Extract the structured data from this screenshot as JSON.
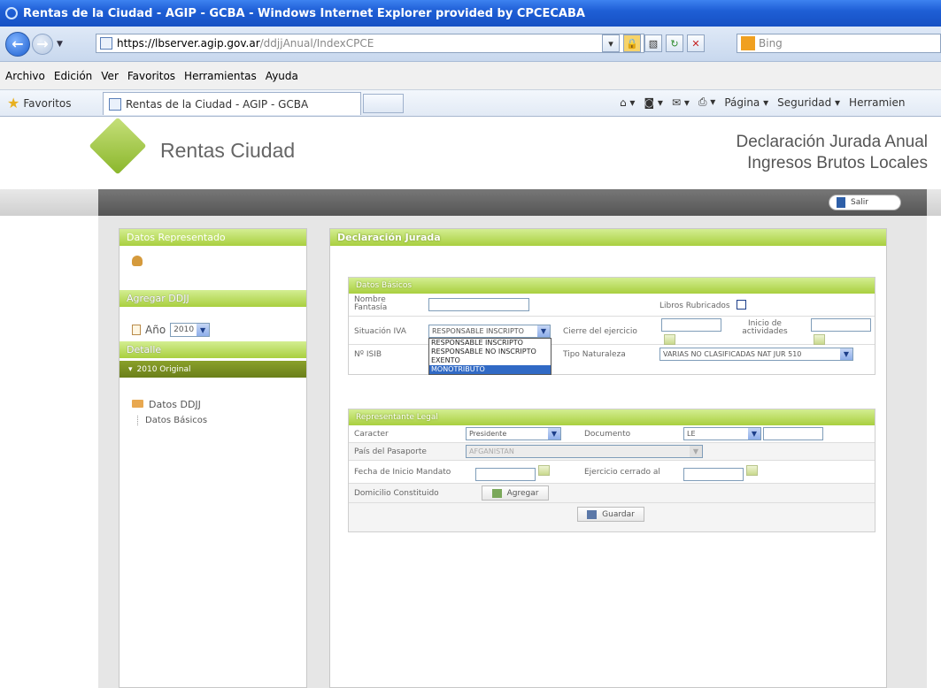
{
  "browser": {
    "window_title": "Rentas de la Ciudad - AGIP - GCBA - Windows Internet Explorer provided by CPCECABA",
    "url_host": "https://lbserver.agip.gov.ar",
    "url_path": "/ddjjAnual/IndexCPCE",
    "search_placeholder": "Bing",
    "menu": [
      "Archivo",
      "Edición",
      "Ver",
      "Favoritos",
      "Herramientas",
      "Ayuda"
    ],
    "favorites_label": "Favoritos",
    "tab_title": "Rentas de la Ciudad - AGIP - GCBA",
    "commands": [
      "Página ▾",
      "Seguridad ▾",
      "Herramien"
    ]
  },
  "header": {
    "brand": "Rentas Ciudad",
    "title_line1": "Declaración Jurada Anual",
    "title_line2": "Ingresos Brutos Locales",
    "logout_label": "Salir"
  },
  "sidebar": {
    "represented_title": "Datos Representado",
    "add_ddjj_title": "Agregar DDJJ",
    "year_label": "Año",
    "year_value": "2010",
    "detail_title": "Detalle",
    "detail_item": "2010 Original",
    "tree_root": "Datos DDJJ",
    "tree_child": "Datos Básicos"
  },
  "main": {
    "title": "Declaración Jurada",
    "basic": {
      "title": "Datos Básicos",
      "fantasy_label": "Nombre Fantasía",
      "fantasy_value": "",
      "books_label": "Libros Rubricados",
      "iva_label": "Situación IVA",
      "iva_value": "RESPONSABLE INSCRIPTO",
      "iva_options": [
        "RESPONSABLE INSCRIPTO",
        "RESPONSABLE NO INSCRIPTO",
        "EXENTO",
        "MONOTRIBUTO"
      ],
      "iva_highlighted": "MONOTRIBUTO",
      "closing_label": "Cierre del ejercicio",
      "start_label": "Inicio de actividades",
      "isib_label": "Nº ISIB",
      "nature_label": "Tipo Naturaleza",
      "nature_value": "VARIAS NO CLASIFICADAS NAT JUR 510"
    },
    "legal": {
      "title": "Representante Legal",
      "caracter_label": "Caracter",
      "caracter_value": "Presidente",
      "documento_label": "Documento",
      "documento_value": "LE",
      "pais_label": "País del Pasaporte",
      "pais_value": "AFGANISTAN",
      "mandato_label": "Fecha de Inicio Mandato",
      "ejercicio_label": "Ejercicio cerrado al",
      "domicilio_label": "Domicilio Constituido",
      "agregar_label": "Agregar",
      "guardar_label": "Guardar"
    }
  }
}
